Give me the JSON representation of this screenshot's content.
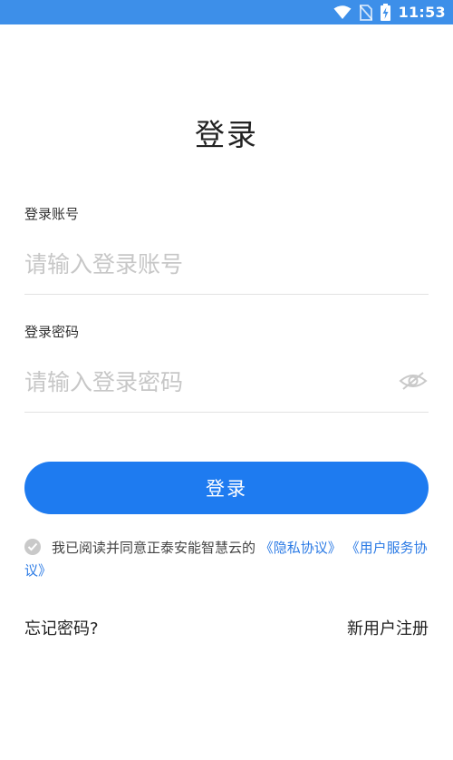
{
  "status_bar": {
    "time": "11:53",
    "icons": [
      "wifi-icon",
      "no-sim-icon",
      "battery-charging-icon"
    ]
  },
  "page": {
    "title": "登录"
  },
  "account": {
    "label": "登录账号",
    "placeholder": "请输入登录账号",
    "value": ""
  },
  "password": {
    "label": "登录密码",
    "placeholder": "请输入登录密码",
    "value": "",
    "visibility_icon": "eye-hidden-icon"
  },
  "login_button": {
    "label": "登录"
  },
  "agreement": {
    "checked": true,
    "text": "我已阅读并同意正泰安能智慧云的",
    "privacy_link": "《隐私协议》",
    "service_link": "《用户服务协议》"
  },
  "footer": {
    "forgot_password": "忘记密码?",
    "register": "新用户注册"
  },
  "colors": {
    "status_bar": "#3d8fe9",
    "primary": "#1e7bf0",
    "link": "#2c7be5",
    "placeholder": "#c7c7c7"
  }
}
